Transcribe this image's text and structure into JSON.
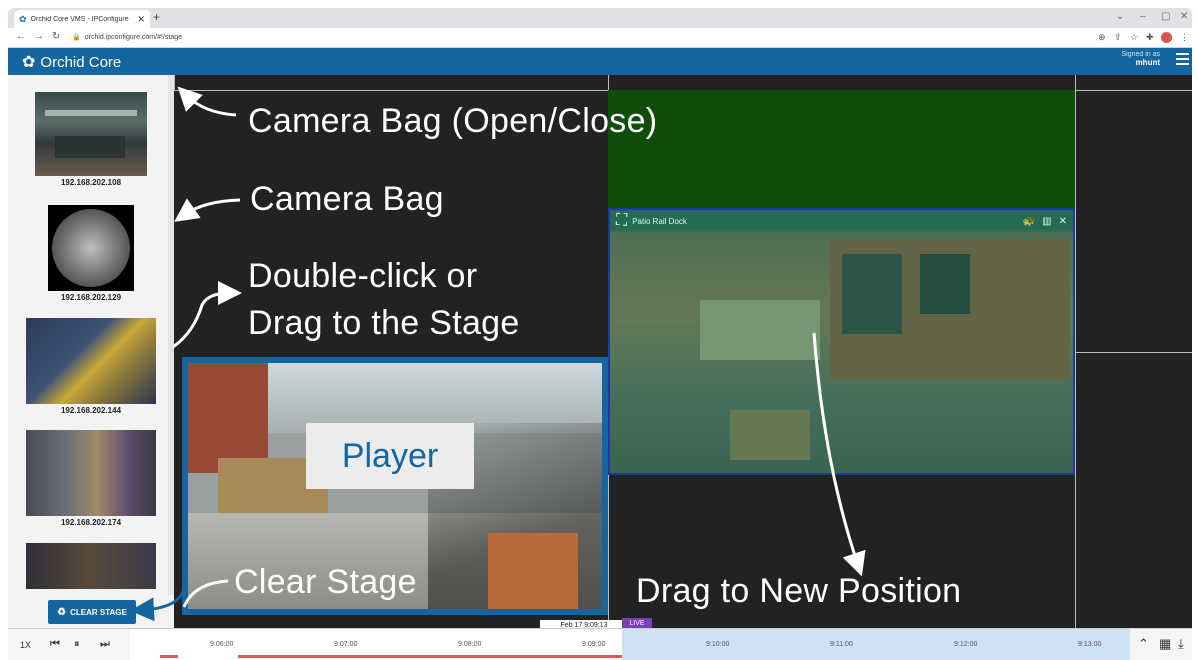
{
  "browser": {
    "tab_title": "Orchid Core VMS - IPConfigure",
    "url": "orchid.ipconfigure.com/#!/stage"
  },
  "app": {
    "brand": "Orchid Core",
    "signed_in_label": "Signed in as",
    "user": "mhunt"
  },
  "camera_bag": {
    "cameras": [
      {
        "ip": "192.168.202.108"
      },
      {
        "ip": "192.168.202.129"
      },
      {
        "ip": "192.168.202.144"
      },
      {
        "ip": "192.168.202.174"
      },
      {
        "ip": ""
      }
    ],
    "clear_button": "CLEAR STAGE"
  },
  "stage": {
    "patio_title": "Patio Rail Dock",
    "player_label": "Player"
  },
  "annotations": {
    "bag_toggle": "Camera Bag (Open/Close)",
    "bag": "Camera Bag",
    "dblclick_line1": "Double-click or",
    "dblclick_line2": "Drag to the Stage",
    "clear": "Clear Stage",
    "drag": "Drag to New Position"
  },
  "timeline": {
    "speed": "1X",
    "ticks": [
      "9:06:00",
      "9:07:00",
      "9:08:00",
      "9:09:00",
      "9:10:00",
      "9:11:00",
      "9:12:00",
      "9:13:00"
    ],
    "current": "Feb 17 9:09:13",
    "live": "LIVE"
  },
  "colors": {
    "brand_blue": "#1565a0",
    "live_purple": "#7b3fbd",
    "recording_red": "#e05555"
  }
}
